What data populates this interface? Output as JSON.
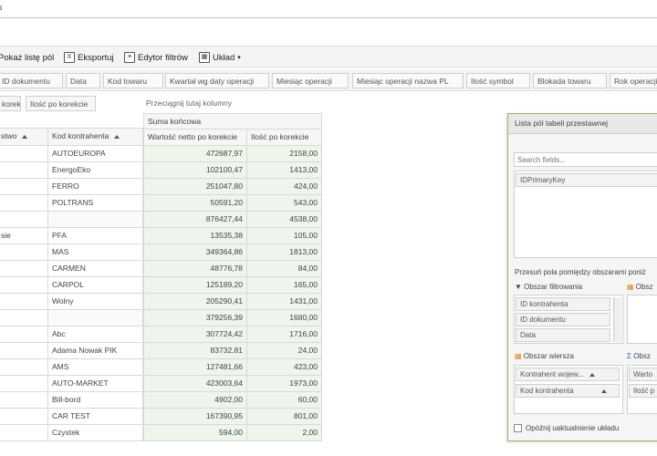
{
  "window": {
    "title_fragment": "s"
  },
  "toolbar": {
    "show_fields_label": "Pokaż listę pól",
    "export_label": "Eksportuj",
    "filter_editor_label": "Edytor filtrów",
    "layout_label": "Układ"
  },
  "field_chips": [
    "ID dokumentu",
    "Data",
    "Kod towaru",
    "Kwartał wg daty operacji",
    "Miesiąc operacji",
    "Miesiąc operacji nazwa PL",
    "Ilość symbol",
    "Blokada towaru",
    "Rok operacji"
  ],
  "data_fields": {
    "left": "korekcie",
    "right": "Ilość po korekcie"
  },
  "drop_columns_hint": "Przeciągnij tutaj kolumny",
  "grid": {
    "sum_header": "Suma końcowa",
    "row_header_1": "stwo",
    "row_header_2": "Kod kontrahenta",
    "col_value_header": "Wartość netto po korekcie",
    "col_qty_header": "Ilość po korekcie",
    "rows": [
      {
        "g": "",
        "k": "AUTOEUROPA",
        "v": "472687,97",
        "q": "2158,00"
      },
      {
        "g": "",
        "k": "EnergoEko",
        "v": "102100,47",
        "q": "1413,00"
      },
      {
        "g": "",
        "k": "FERRO",
        "v": "251047,80",
        "q": "424,00"
      },
      {
        "g": "",
        "k": "POLTRANS",
        "v": "50591,20",
        "q": "543,00"
      },
      {
        "g": "",
        "k": "",
        "v": "876427,44",
        "q": "4538,00"
      },
      {
        "g": "sie",
        "k": "PFA",
        "v": "13535,38",
        "q": "105,00"
      },
      {
        "g": "",
        "k": "MAS",
        "v": "349364,86",
        "q": "1813,00"
      },
      {
        "g": "",
        "k": "CARMEN",
        "v": "48776,78",
        "q": "84,00"
      },
      {
        "g": "",
        "k": "CARPOL",
        "v": "125189,20",
        "q": "165,00"
      },
      {
        "g": "",
        "k": "Wolny",
        "v": "205290,41",
        "q": "1431,00"
      },
      {
        "g": "",
        "k": "",
        "v": "379256,39",
        "q": "1680,00"
      },
      {
        "g": "",
        "k": "Abc",
        "v": "307724,42",
        "q": "1716,00"
      },
      {
        "g": "",
        "k": "Adama Nowak PIK",
        "v": "83732,81",
        "q": "24,00"
      },
      {
        "g": "",
        "k": "AMS",
        "v": "127481,66",
        "q": "423,00"
      },
      {
        "g": "",
        "k": "AUTO-MARKET",
        "v": "423003,64",
        "q": "1973,00"
      },
      {
        "g": "",
        "k": "Bill-bord",
        "v": "4902,00",
        "q": "60,00"
      },
      {
        "g": "",
        "k": "CAR TEST",
        "v": "167390,95",
        "q": "801,00"
      },
      {
        "g": "",
        "k": "Czystek",
        "v": "594,00",
        "q": "2,00"
      }
    ]
  },
  "panel": {
    "title": "Lista pól tabeli przestawnej",
    "search_placeholder": "Search fields...",
    "field_item": "IDPrimaryKey",
    "move_hint": "Przesuń pola pomiędzy obszarami poniż",
    "filter_area": "Obszar filtrowania",
    "columns_area": "Obsz",
    "filter_items": [
      "ID kontrahenta",
      "ID dokumentu",
      "Data"
    ],
    "row_area": "Obszar wiersza",
    "values_area": "Obsz",
    "row_items": [
      "Kontrahent wojew...",
      "Kod kontrahenta"
    ],
    "value_items": [
      "Warto",
      "Ilość p"
    ],
    "defer_label": "Opóźnij uaktualnienie układu"
  }
}
